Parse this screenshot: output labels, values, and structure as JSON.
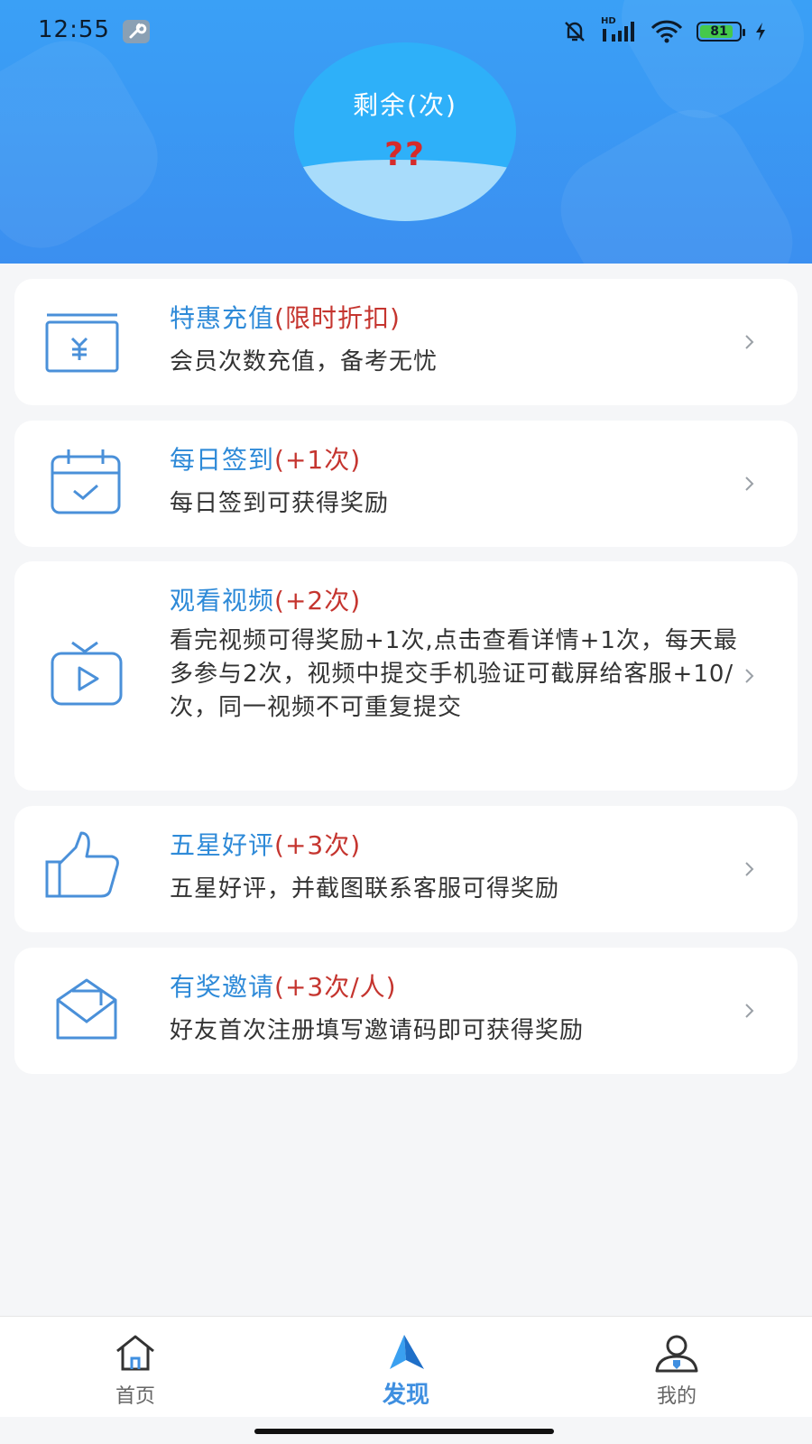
{
  "status_bar": {
    "time": "12:55",
    "battery": "81",
    "network": "HD"
  },
  "header": {
    "remaining_label": "剩余(次)",
    "remaining_count": "??"
  },
  "cards": [
    {
      "title": "特惠充值",
      "tag": "(限时折扣)",
      "desc": "会员次数充值，备考无忧",
      "icon": "recharge-yen-icon"
    },
    {
      "title": "每日签到",
      "tag": "(+1次)",
      "desc": "每日签到可获得奖励",
      "icon": "calendar-check-icon"
    },
    {
      "title": "观看视频",
      "tag": "(+2次)",
      "desc": "看完视频可得奖励+1次,点击查看详情+1次，每天最多参与2次，视频中提交手机验证可截屏给客服+10/次，同一视频不可重复提交",
      "icon": "tv-play-icon"
    },
    {
      "title": "五星好评",
      "tag": "(+3次)",
      "desc": "五星好评，并截图联系客服可得奖励",
      "icon": "thumbs-up-icon"
    },
    {
      "title": "有奖邀请",
      "tag": "(+3次/人)",
      "desc": "好友首次注册填写邀请码即可获得奖励",
      "icon": "envelope-icon"
    }
  ],
  "tabbar": {
    "tabs": [
      {
        "label": "首页",
        "icon": "home-icon"
      },
      {
        "label": "发现",
        "icon": "discover-arrow-icon"
      },
      {
        "label": "我的",
        "icon": "profile-icon"
      }
    ],
    "active_index": 1
  },
  "colors": {
    "header_blue": "#3a95f2",
    "title_blue": "#2e8ad8",
    "tag_red": "#c5352f",
    "count_red": "#d52b2b",
    "tab_active": "#3f8fe0"
  }
}
